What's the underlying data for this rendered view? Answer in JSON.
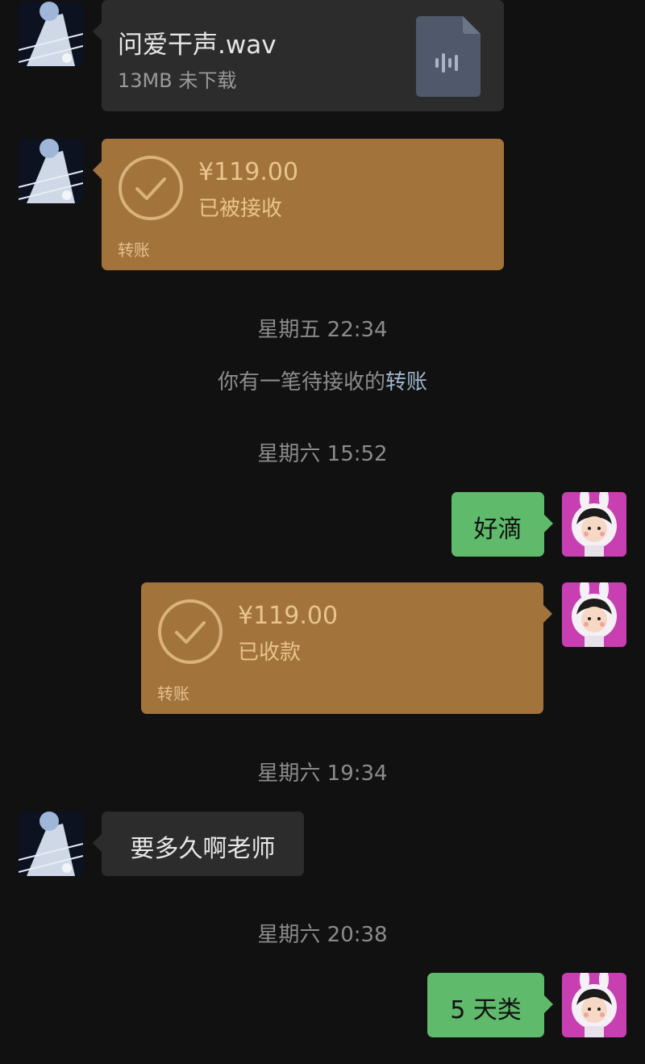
{
  "messages": {
    "file": {
      "name": "问爱干声.wav",
      "meta": "13MB  未下载",
      "icon": "audio-file-icon"
    },
    "transfer_received": {
      "amount": "¥119.00",
      "status": "已被接收",
      "label": "转账"
    },
    "timestamp_1": "星期五 22:34",
    "system_notice": {
      "text": "你有一笔待接收的",
      "link": "转账"
    },
    "timestamp_2": "星期六 15:52",
    "reply_1": "好滴",
    "transfer_collected": {
      "amount": "¥119.00",
      "status": "已收款",
      "label": "转账"
    },
    "timestamp_3": "星期六 19:34",
    "question": "要多久啊老师",
    "timestamp_4": "星期六 20:38",
    "reply_2": "5 天类"
  },
  "colors": {
    "background": "#111111",
    "bubble_gray": "#2c2c2c",
    "bubble_green": "#5fba6b",
    "transfer_orange": "#a3733c"
  }
}
